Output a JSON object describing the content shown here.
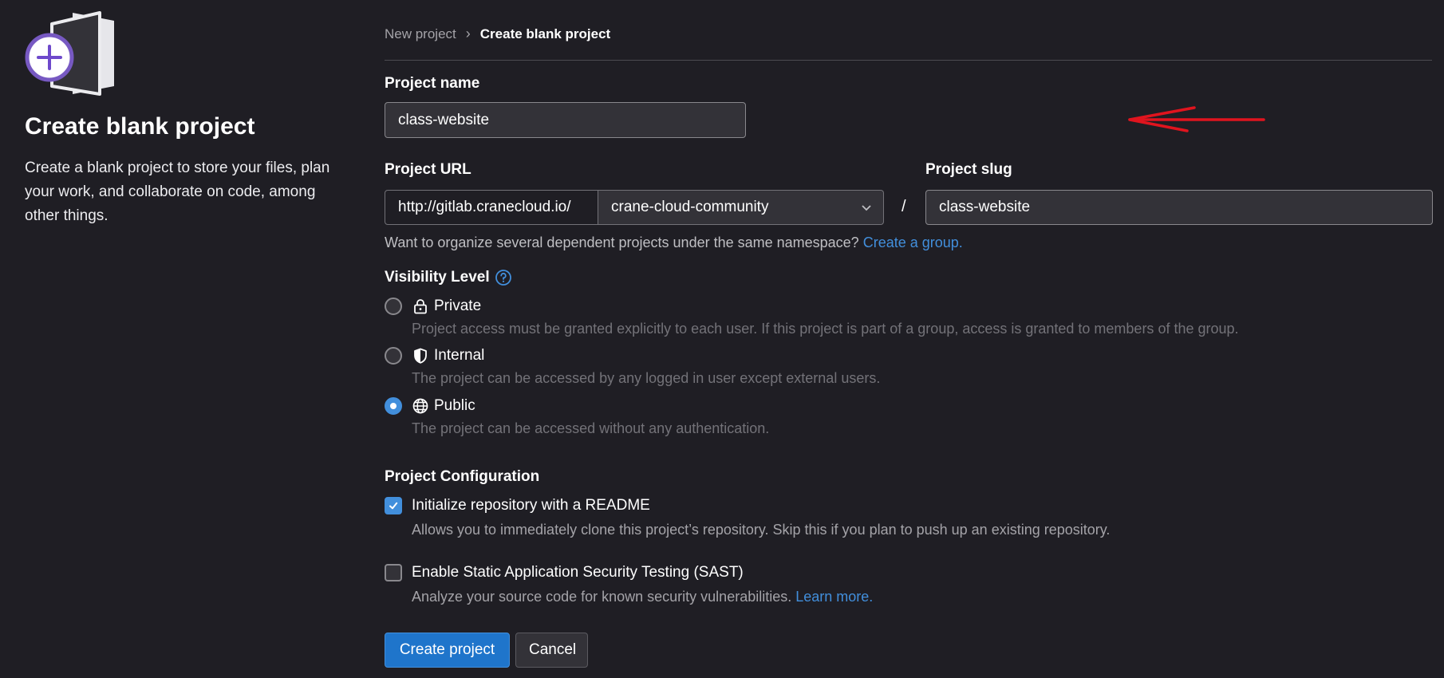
{
  "sidebar": {
    "title": "Create blank project",
    "description": "Create a blank project to store your files, plan your work, and collaborate on code, among other things."
  },
  "breadcrumb": {
    "parent": "New project",
    "current": "Create blank project"
  },
  "form": {
    "project_name_label": "Project name",
    "project_name_value": "class-website",
    "project_url_label": "Project URL",
    "url_prefix": "http://gitlab.cranecloud.io/",
    "namespace": "crane-cloud-community",
    "separator": "/",
    "project_slug_label": "Project slug",
    "project_slug_value": "class-website",
    "group_help_text": "Want to organize several dependent projects under the same namespace?",
    "group_help_link": "Create a group."
  },
  "visibility": {
    "label": "Visibility Level",
    "selected": "public",
    "options": [
      {
        "key": "private",
        "label": "Private",
        "icon": "lock-icon",
        "description": "Project access must be granted explicitly to each user. If this project is part of a group, access is granted to members of the group."
      },
      {
        "key": "internal",
        "label": "Internal",
        "icon": "shield-icon",
        "description": "The project can be accessed by any logged in user except external users."
      },
      {
        "key": "public",
        "label": "Public",
        "icon": "globe-icon",
        "description": "The project can be accessed without any authentication."
      }
    ]
  },
  "configuration": {
    "label": "Project Configuration",
    "readme": {
      "label": "Initialize repository with a README",
      "checked": true,
      "description": "Allows you to immediately clone this project’s repository. Skip this if you plan to push up an existing repository."
    },
    "sast": {
      "label": "Enable Static Application Security Testing (SAST)",
      "checked": false,
      "description": "Analyze your source code for known security vulnerabilities.",
      "link": "Learn more."
    }
  },
  "actions": {
    "create_label": "Create project",
    "cancel_label": "Cancel"
  },
  "colors": {
    "background": "#1f1e24",
    "accent": "#428fdc",
    "annotation_arrow": "#e0141e"
  }
}
